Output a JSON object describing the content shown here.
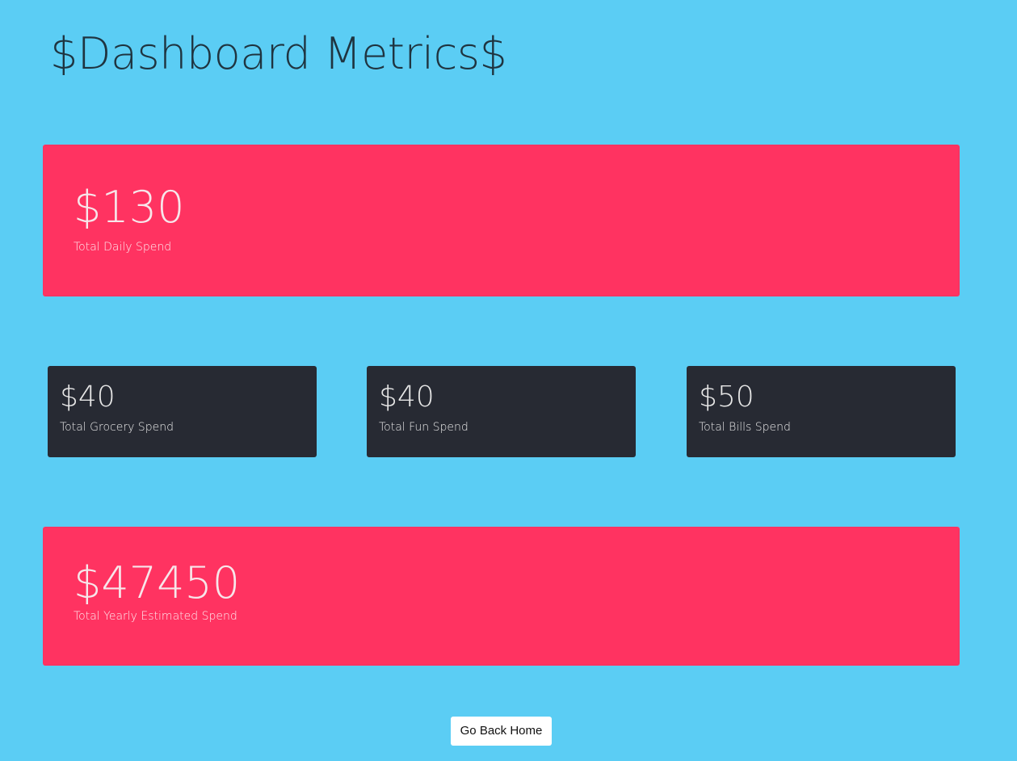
{
  "header": {
    "title": "$Dashboard Metrics$"
  },
  "metrics": {
    "daily": {
      "value": "$130",
      "label": "Total Daily Spend"
    },
    "grocery": {
      "value": "$40",
      "label": "Total Grocery Spend"
    },
    "fun": {
      "value": "$40",
      "label": "Total Fun Spend"
    },
    "bills": {
      "value": "$50",
      "label": "Total Bills Spend"
    },
    "yearly": {
      "value": "$47450",
      "label": "Total Yearly Estimated Spend"
    }
  },
  "actions": {
    "home_label": "Go Back Home"
  },
  "colors": {
    "background": "#5bcdf4",
    "accent_card": "#ff3361",
    "dark_card": "#272a33",
    "button": "#ffffff"
  }
}
